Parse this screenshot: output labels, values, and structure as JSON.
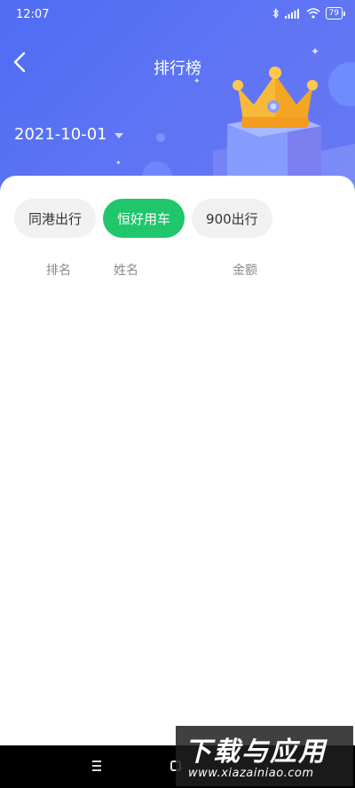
{
  "status_bar": {
    "time": "12:07",
    "battery": "79"
  },
  "header": {
    "title": "排行榜",
    "date": "2021-10-01"
  },
  "tabs": [
    {
      "label": "同港出行",
      "active": false
    },
    {
      "label": "恒好用车",
      "active": true
    },
    {
      "label": "900出行",
      "active": false
    }
  ],
  "table": {
    "columns": [
      "排名",
      "姓名",
      "金额"
    ],
    "rows": []
  },
  "watermark": {
    "main": "下载与应用",
    "sub": "www.xiazainiao.com"
  },
  "colors": {
    "header_bg": "#5570f4",
    "active_tab": "#1fc66b",
    "crown": "#f8b93a"
  },
  "icons": [
    "back-arrow-icon",
    "dropdown-caret-icon",
    "crown-icon",
    "bluetooth-icon",
    "signal-icon",
    "wifi-icon",
    "battery-icon"
  ]
}
